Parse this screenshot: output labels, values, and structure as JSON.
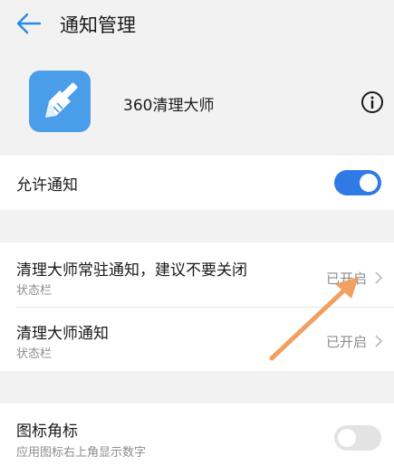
{
  "header": {
    "title": "通知管理",
    "back_icon": "back-arrow-icon"
  },
  "app": {
    "name": "360清理大师",
    "icon": "broom-icon",
    "info_icon": "info-icon",
    "icon_color": "#4a9de8"
  },
  "allow_notifications": {
    "label": "允许通知",
    "enabled": true,
    "accent": "#2f7ae5"
  },
  "channels": [
    {
      "label": "清理大师常驻通知，建议不要关闭",
      "sub": "状态栏",
      "status": "已开启"
    },
    {
      "label": "清理大师通知",
      "sub": "状态栏",
      "status": "已开启"
    }
  ],
  "badge": {
    "label": "图标角标",
    "sub": "应用图标右上角显示数字",
    "enabled": false
  },
  "annotation": {
    "arrow_color": "#f0a060"
  }
}
